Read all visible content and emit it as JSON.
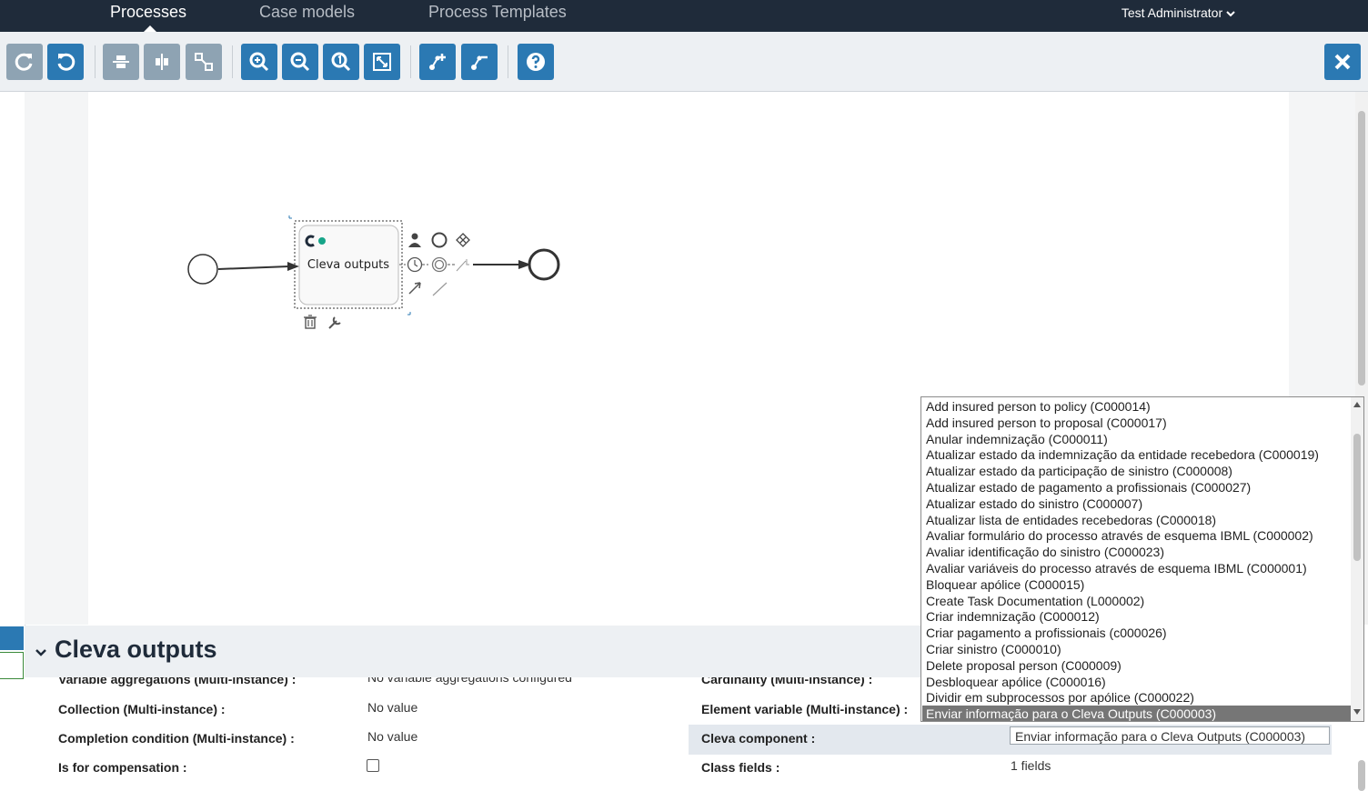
{
  "nav": {
    "tabs": [
      "Processes",
      "Case models",
      "Process Templates"
    ],
    "user": "Test Administrator"
  },
  "toolbar": {
    "buttons": [
      "redo-icon",
      "undo-icon",
      "align-horizontal-icon",
      "align-vertical-icon",
      "same-size-icon",
      "zoom-in-icon",
      "zoom-out-icon",
      "zoom-actual-icon",
      "zoom-fit-icon",
      "add-bendpoint-icon",
      "remove-bendpoint-icon",
      "help-icon"
    ],
    "close": "close-icon"
  },
  "diagram": {
    "task_label": "Cleva outputs"
  },
  "panel": {
    "title": "Cleva outputs",
    "rows": {
      "variable_aggregations_label": "Variable aggregations (Multi-instance) :",
      "variable_aggregations_value": "No variable aggregations configured",
      "cardinality_label": "Cardinality (Multi-instance) :",
      "collection_label": "Collection (Multi-instance) :",
      "collection_value": "No value",
      "element_variable_label": "Element variable (Multi-instance) :",
      "completion_label": "Completion condition (Multi-instance) :",
      "completion_value": "No value",
      "cleva_component_label": "Cleva component :",
      "cleva_component_value": "Enviar informação para o Cleva Outputs (C000003)",
      "compensation_label": "Is for compensation :",
      "class_fields_label": "Class fields :",
      "class_fields_value": "1 fields"
    }
  },
  "dropdown": {
    "options": [
      "Add insured person to policy (C000014)",
      "Add insured person to proposal (C000017)",
      "Anular indemnização (C000011)",
      "Atualizar estado da indemnização da entidade recebedora (C000019)",
      "Atualizar estado da participação de sinistro (C000008)",
      "Atualizar estado de pagamento a profissionais (C000027)",
      "Atualizar estado do sinistro (C000007)",
      "Atualizar lista de entidades recebedoras (C000018)",
      "Avaliar formulário do processo através de esquema IBML (C000002)",
      "Avaliar identificação do sinistro (C000023)",
      "Avaliar variáveis do processo através de esquema IBML (C000001)",
      "Bloquear apólice (C000015)",
      "Create Task Documentation (L000002)",
      "Criar indemnização (C000012)",
      "Criar pagamento a profissionais (c000026)",
      "Criar sinistro (C000010)",
      "Delete proposal person (C000009)",
      "Desbloquear apólice (C000016)",
      "Dividir em subprocessos por apólice (C000022)",
      "Enviar informação para o Cleva Outputs (C000003)"
    ],
    "selected_index": 19
  },
  "colors": {
    "topbar": "#1f2b3a",
    "accent": "#2b79b3",
    "disabled": "#8ea3b3"
  }
}
